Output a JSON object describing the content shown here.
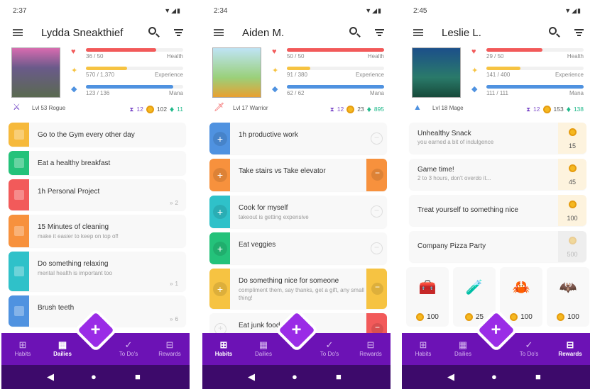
{
  "colors": {
    "health": "#f25a5a",
    "experience": "#f6c342",
    "mana": "#4f92e0",
    "nav": "#6c12b5",
    "system_nav": "#3d0a6b",
    "fab": "#9a2ce6",
    "gems": "#1fb98a",
    "hourglass": "#7d4cc9"
  },
  "labels": {
    "health": "Health",
    "experience": "Experience",
    "mana": "Mana"
  },
  "nav": [
    {
      "label": "Habits",
      "icon": "habits-icon"
    },
    {
      "label": "Dailies",
      "icon": "calendar-icon"
    },
    {
      "label": "To Do's",
      "icon": "check-circle-icon"
    },
    {
      "label": "Rewards",
      "icon": "chest-icon"
    }
  ],
  "phones": [
    {
      "time": "2:37",
      "name": "Lydda Sneakthief",
      "health": "36 / 50",
      "health_pct": 72,
      "exp": "570 / 1,370",
      "exp_pct": 42,
      "mana": "123 / 136",
      "mana_pct": 90,
      "level": "Lvl 53 Rogue",
      "class_icon": "rogue-icon",
      "hourglasses": "12",
      "gold": "102",
      "gems": "11",
      "active_tab": 1,
      "dailies": [
        {
          "title": "Go to the Gym every other day",
          "color": "#f6b93b"
        },
        {
          "title": "Eat a healthy breakfast",
          "color": "#24c27a"
        },
        {
          "title": "1h Personal Project",
          "color": "#f25a5a",
          "streak": "2"
        },
        {
          "title": "15 Minutes of cleaning",
          "notes": "make it easier to keep on top of!",
          "color": "#f7913d"
        },
        {
          "title": "Do something relaxing",
          "notes": "mental health is important too",
          "color": "#2fc1c9",
          "streak": "1"
        },
        {
          "title": "Brush teeth",
          "color": "#4f92e0",
          "streak": "6"
        }
      ]
    },
    {
      "time": "2:34",
      "name": "Aiden M.",
      "health": "50 / 50",
      "health_pct": 100,
      "exp": "91 / 380",
      "exp_pct": 24,
      "mana": "62 / 62",
      "mana_pct": 100,
      "level": "Lvl 17 Warrior",
      "class_icon": "warrior-sword-icon",
      "hourglasses": "12",
      "gold": "23",
      "gems": "895",
      "active_tab": 0,
      "habits": [
        {
          "title": "1h productive work",
          "color": "#4f92e0",
          "up": true,
          "down": false
        },
        {
          "title": "Take stairs vs Take elevator",
          "color": "#f7913d",
          "up": true,
          "down": true
        },
        {
          "title": "Cook for myself",
          "notes": "takeout is getting expensive",
          "color": "#2fc1c9",
          "up": true,
          "down": false
        },
        {
          "title": "Eat veggies",
          "color": "#24c27a",
          "up": true,
          "down": false
        },
        {
          "title": "Do something nice for someone",
          "notes": "compliment them, say thanks, get a gift, any small thing!",
          "color": "#f6c342",
          "up": true,
          "down": true
        },
        {
          "title": "Eat junk food",
          "color": "#f25a5a",
          "up": false,
          "down": true
        }
      ]
    },
    {
      "time": "2:45",
      "name": "Leslie L.",
      "health": "29 / 50",
      "health_pct": 58,
      "exp": "141 / 400",
      "exp_pct": 35,
      "mana": "111 / 111",
      "mana_pct": 100,
      "level": "Lvl 18 Mage",
      "class_icon": "mage-icon",
      "hourglasses": "12",
      "gold": "153",
      "gems": "138",
      "active_tab": 3,
      "rewards": [
        {
          "title": "Unhealthy Snack",
          "notes": "you earned a bit of indulgence",
          "price": "15",
          "affordable": true
        },
        {
          "title": "Game time!",
          "notes": "2 to 3 hours, don't overdo it...",
          "price": "45",
          "affordable": true
        },
        {
          "title": "Treat yourself to something nice",
          "price": "100",
          "affordable": true
        },
        {
          "title": "Company Pizza Party",
          "price": "500",
          "affordable": false
        }
      ],
      "shop": [
        {
          "item": "armoire-chest",
          "glyph": "🧰",
          "price": "100"
        },
        {
          "item": "health-potion",
          "glyph": "🧪",
          "price": "25"
        },
        {
          "item": "red-armor",
          "glyph": "🦀",
          "price": "100"
        },
        {
          "item": "green-armor",
          "glyph": "🦇",
          "price": "100"
        }
      ]
    }
  ]
}
